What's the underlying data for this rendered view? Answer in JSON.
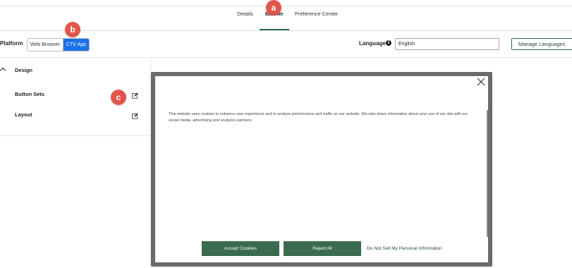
{
  "tabs": [
    {
      "label": "Details"
    },
    {
      "label": "Banner"
    },
    {
      "label": "Preference Center"
    }
  ],
  "markers": {
    "a": "a",
    "b": "b",
    "c": "c"
  },
  "platform": {
    "label": "Platform",
    "options": [
      "Web Browser",
      "CTV App"
    ],
    "selected": "CTV App"
  },
  "language": {
    "label": "Language",
    "info_icon": "i",
    "value": "English",
    "manage_label": "Manage Languages"
  },
  "sidebar": {
    "section_title": "Design",
    "items": [
      {
        "label": "Button Sets"
      },
      {
        "label": "Layout"
      }
    ]
  },
  "banner": {
    "text": "This website uses cookies to enhance user experience and to analyze performance and traffic on our website. We also share information about your use of our site with our social media, advertising and analytics partners.",
    "accept_label": "Accept Cookies",
    "reject_label": "Reject All",
    "dns_label": "Do Not Sell My Personal Information"
  },
  "colors": {
    "accent_green": "#3a6b4e",
    "selected_blue": "#1a72e8",
    "marker_red": "#e0564b"
  }
}
